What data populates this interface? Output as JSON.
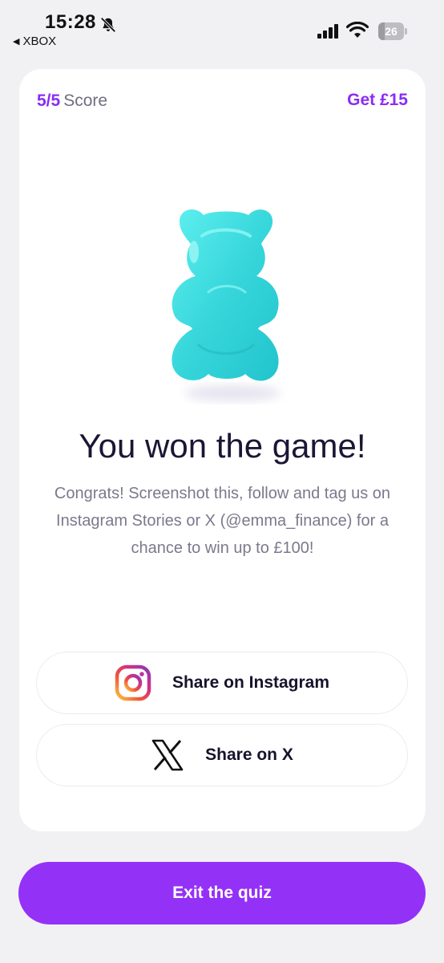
{
  "status_bar": {
    "time": "15:28",
    "back_app": "XBOX",
    "battery": "26",
    "battery_level": 0.26,
    "icons": [
      "bell-slash-icon",
      "signal-icon",
      "wifi-icon",
      "battery-icon"
    ]
  },
  "header": {
    "score_value": "5/5",
    "score_label": "Score",
    "reward_link": "Get £15"
  },
  "result": {
    "illustration": "gummy-bear",
    "headline": "You won the game!",
    "description": "Congrats! Screenshot this, follow and tag us on Instagram Stories or X (@emma_finance) for a chance to win up to £100!"
  },
  "share": {
    "instagram_label": "Share on Instagram",
    "x_label": "Share on X"
  },
  "footer": {
    "exit_label": "Exit the quiz"
  },
  "colors": {
    "accent": "#9431f7",
    "accent_text": "#8b2cf5",
    "background": "#f1f1f4",
    "card": "#ffffff",
    "gummy": "#3fdde0"
  }
}
